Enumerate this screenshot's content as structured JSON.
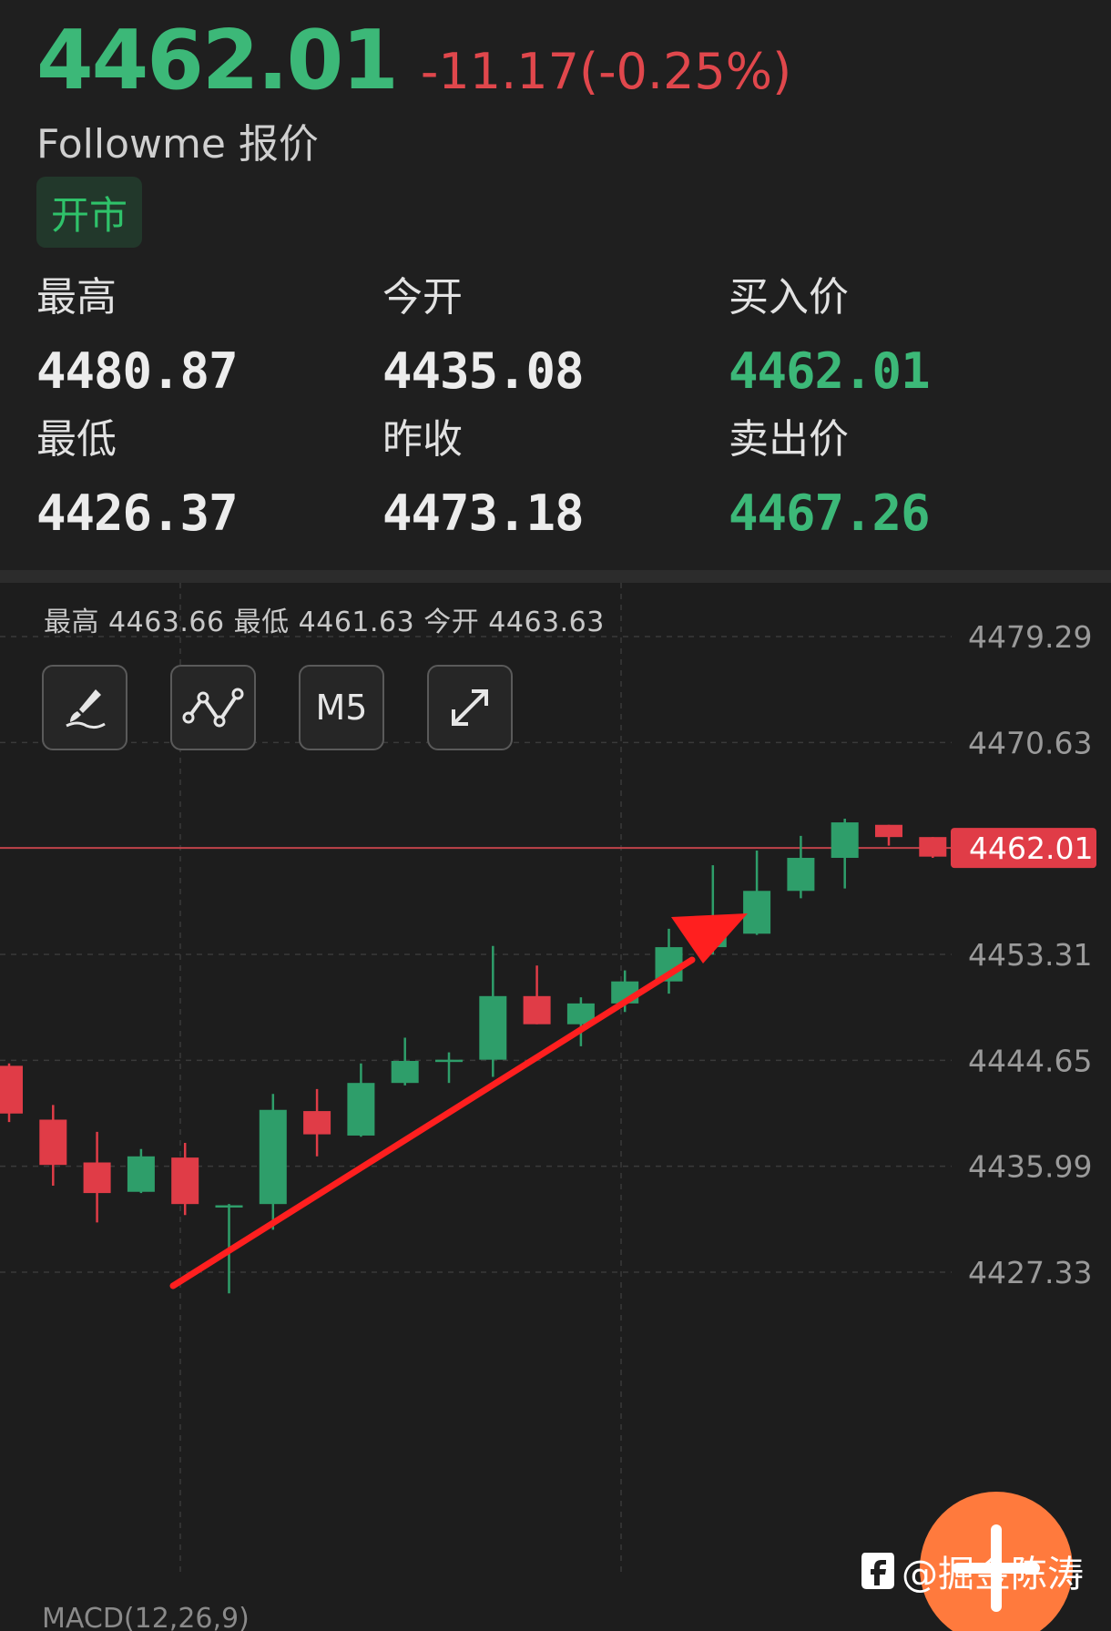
{
  "quote": {
    "price": "4462.01",
    "change": "-11.17(-0.25%)",
    "source": "Followme 报价",
    "status": "开市"
  },
  "stats": [
    {
      "label": "最高",
      "value": "4480.87",
      "green": false
    },
    {
      "label": "今开",
      "value": "4435.08",
      "green": false
    },
    {
      "label": "买入价",
      "value": "4462.01",
      "green": true
    },
    {
      "label": "最低",
      "value": "4426.37",
      "green": false
    },
    {
      "label": "昨收",
      "value": "4473.18",
      "green": false
    },
    {
      "label": "卖出价",
      "value": "4467.26",
      "green": true
    }
  ],
  "ohlc_info": "最高 4463.66  最低 4461.63  今开 4463.63",
  "toolbar": {
    "draw_icon": "pen-brush-icon",
    "indicator_icon": "line-chart-icon",
    "ma_label": "M5",
    "expand_icon": "expand-arrows-icon"
  },
  "colors": {
    "up": "#2e9e6a",
    "down": "#e03c47",
    "price_line": "#c0434a",
    "arrow": "#ff1f1f"
  },
  "chart_data": {
    "type": "candlestick",
    "y_ticks": [
      "4479.29",
      "4470.63",
      "4462.01",
      "4453.31",
      "4444.65",
      "4435.99",
      "4427.33"
    ],
    "current_price_tag": "4462.01",
    "current_price": 4462.01,
    "ylim": [
      4427.33,
      4479.29
    ],
    "grid": true,
    "candles": [
      {
        "o": 4444.2,
        "h": 4444.4,
        "l": 4439.6,
        "c": 4440.3
      },
      {
        "o": 4439.8,
        "h": 4441.0,
        "l": 4434.4,
        "c": 4436.1
      },
      {
        "o": 4436.3,
        "h": 4438.8,
        "l": 4431.4,
        "c": 4433.8
      },
      {
        "o": 4433.9,
        "h": 4437.4,
        "l": 4433.8,
        "c": 4436.8
      },
      {
        "o": 4436.7,
        "h": 4437.9,
        "l": 4432.0,
        "c": 4432.9
      },
      {
        "o": 4432.8,
        "h": 4432.9,
        "l": 4425.6,
        "c": 4432.8
      },
      {
        "o": 4432.9,
        "h": 4441.9,
        "l": 4430.8,
        "c": 4440.6
      },
      {
        "o": 4440.5,
        "h": 4442.3,
        "l": 4436.8,
        "c": 4438.6
      },
      {
        "o": 4438.5,
        "h": 4444.4,
        "l": 4438.4,
        "c": 4442.8
      },
      {
        "o": 4442.8,
        "h": 4446.5,
        "l": 4442.6,
        "c": 4444.6
      },
      {
        "o": 4444.6,
        "h": 4445.3,
        "l": 4442.8,
        "c": 4444.7
      },
      {
        "o": 4444.7,
        "h": 4454.0,
        "l": 4443.3,
        "c": 4449.9
      },
      {
        "o": 4449.9,
        "h": 4452.4,
        "l": 4447.6,
        "c": 4447.6
      },
      {
        "o": 4447.6,
        "h": 4449.8,
        "l": 4445.8,
        "c": 4449.3
      },
      {
        "o": 4449.3,
        "h": 4452.0,
        "l": 4448.6,
        "c": 4451.1
      },
      {
        "o": 4451.1,
        "h": 4455.4,
        "l": 4450.1,
        "c": 4453.9
      },
      {
        "o": 4453.9,
        "h": 4460.6,
        "l": 4453.3,
        "c": 4455.0
      },
      {
        "o": 4455.0,
        "h": 4461.8,
        "l": 4454.9,
        "c": 4458.5
      },
      {
        "o": 4458.5,
        "h": 4463.0,
        "l": 4457.9,
        "c": 4461.2
      },
      {
        "o": 4461.2,
        "h": 4464.4,
        "l": 4458.7,
        "c": 4464.1
      },
      {
        "o": 4463.9,
        "h": 4463.9,
        "l": 4462.2,
        "c": 4462.9
      },
      {
        "o": 4462.9,
        "h": 4462.9,
        "l": 4461.2,
        "c": 4461.3
      }
    ]
  },
  "watermark": "@掘金陈涛",
  "macd_label": "MACD(12,26,9)"
}
